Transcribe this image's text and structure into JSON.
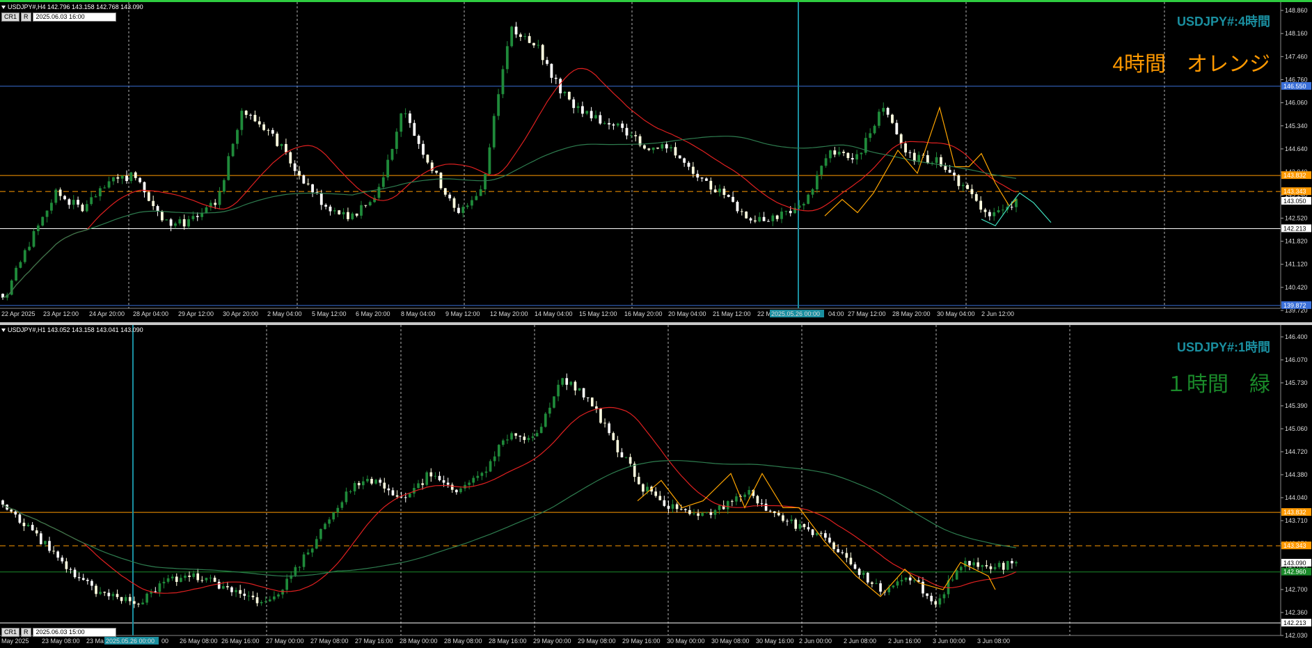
{
  "colors": {
    "background": "#000000",
    "bull": "#1f8a3a",
    "bear": "#ffffff",
    "bull_alt": "#ffffe0",
    "ma_red": "#e02020",
    "ma_green": "#2e7d4f",
    "zigzag_orange": "#ffa500",
    "zigzag_cyan": "#40e0c0",
    "level_orange": "#ff9900",
    "level_blue": "#3a6fd8",
    "level_white": "#ffffff",
    "vline": "#1a8fa0",
    "grid": "#e0e0e0",
    "symbol_title": "#1a8fa0",
    "tf_orange": "#ff9900",
    "tf_green": "#1a8a2a"
  },
  "top": {
    "header": "USDJPY#,H4  142.796 143.158 142.768 143.090",
    "buttons": [
      "CR1",
      "R"
    ],
    "datetime": "2025.06.03 16:00",
    "symbol_title": "USDJPY#:4時間",
    "big_label": "4時間　オレンジ",
    "price_axis": [
      "148.860",
      "148.160",
      "147.460",
      "146.760",
      "146.060",
      "145.340",
      "144.640",
      "143.940",
      "143.240",
      "142.520",
      "141.820",
      "141.120",
      "140.420",
      "139.720"
    ],
    "price_badges": [
      {
        "text": "146.550",
        "color": "#3a6fd8",
        "price": 146.55
      },
      {
        "text": "143.832",
        "color": "#ff9900",
        "price": 143.832
      },
      {
        "text": "143.343",
        "color": "#ff9900",
        "price": 143.343
      },
      {
        "text": "143.050",
        "color": "#ffffff",
        "price": 143.05
      },
      {
        "text": "142.213",
        "color": "#ffffff",
        "price": 142.213
      },
      {
        "text": "139.872",
        "color": "#3a6fd8",
        "price": 139.872
      }
    ],
    "time_axis": [
      "22 Apr 2025",
      "23 Apr 12:00",
      "24 Apr 20:00",
      "28 Apr 04:00",
      "29 Apr 12:00",
      "30 Apr 20:00",
      "2 May 04:00",
      "5 May 12:00",
      "6 May 20:00",
      "8 May 04:00",
      "9 May 12:00",
      "12 May 20:00",
      "14 May 04:00",
      "15 May 12:00",
      "16 May 20:00",
      "20 May 04:00",
      "21 May 12:00",
      "22 M",
      "2025.05.26 00:00",
      "04:00",
      "27 May 12:00",
      "28 May 20:00",
      "30 May 04:00",
      "2 Jun 12:00"
    ]
  },
  "bottom": {
    "header": "USDJPY#,H1  143.052 143.158 143.041 143.090",
    "buttons": [
      "CR1",
      "R"
    ],
    "datetime": "2025.06.03 15:00",
    "symbol_title": "USDJPY#:1時間",
    "big_label": "１時間　緑",
    "price_axis": [
      "146.400",
      "146.070",
      "145.730",
      "145.390",
      "145.060",
      "144.720",
      "144.380",
      "144.040",
      "143.710",
      "143.370",
      "143.030",
      "142.700",
      "142.360",
      "142.030"
    ],
    "price_badges": [
      {
        "text": "143.832",
        "color": "#ff9900",
        "price": 143.832
      },
      {
        "text": "143.343",
        "color": "#ff9900",
        "price": 143.343
      },
      {
        "text": "143.090",
        "color": "#ffffff",
        "price": 143.09
      },
      {
        "text": "142.960",
        "color": "#1a8a2a",
        "price": 142.96
      },
      {
        "text": "142.213",
        "color": "#ffffff",
        "price": 142.213
      }
    ],
    "time_axis": [
      "May 2025",
      "23 May 08:00",
      "23 Ma",
      "2025.05.26 00:00",
      "00",
      "26 May 08:00",
      "26 May 16:00",
      "27 May 00:00",
      "27 May 08:00",
      "27 May 16:00",
      "28 May 00:00",
      "28 May 08:00",
      "28 May 16:00",
      "29 May 00:00",
      "29 May 08:00",
      "29 May 16:00",
      "30 May 00:00",
      "30 May 08:00",
      "30 May 16:00",
      "2 Jun 00:00",
      "2 Jun 08:00",
      "2 Jun 16:00",
      "3 Jun 00:00",
      "3 Jun 08:00"
    ]
  }
}
